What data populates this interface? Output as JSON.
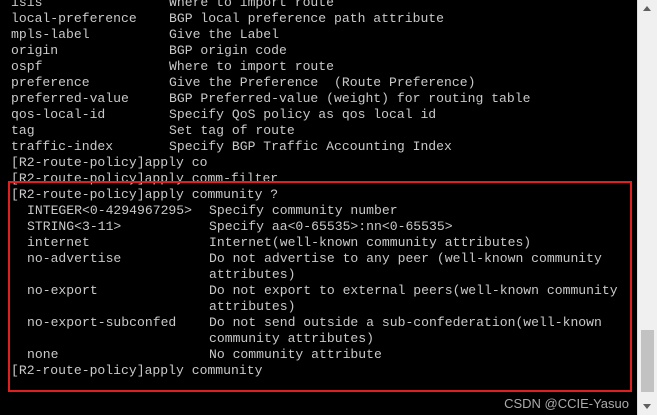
{
  "terminal": {
    "options_top": [
      {
        "name": "isis",
        "help": "Where to import route"
      },
      {
        "name": "local-preference",
        "help": "BGP local preference path attribute"
      },
      {
        "name": "mpls-label",
        "help": "Give the Label"
      },
      {
        "name": "origin",
        "help": "BGP origin code"
      },
      {
        "name": "ospf",
        "help": "Where to import route"
      },
      {
        "name": "preference",
        "help": "Give the Preference  (Route Preference)"
      },
      {
        "name": "preferred-value",
        "help": "BGP Preferred-value (weight) for routing table"
      },
      {
        "name": "qos-local-id",
        "help": "Specify QoS policy as qos local id"
      },
      {
        "name": "tag",
        "help": "Set tag of route"
      },
      {
        "name": "traffic-index",
        "help": "Specify BGP Traffic Accounting Index"
      }
    ],
    "commands_mid": [
      "[R2-route-policy]apply co",
      "[R2-route-policy]apply comm-filter",
      "[R2-route-policy]apply community ?"
    ],
    "community_options": [
      {
        "name": "INTEGER<0-4294967295>",
        "help": [
          "Specify community number"
        ]
      },
      {
        "name": "STRING<3-11>",
        "help": [
          "Specify aa<0-65535>:nn<0-65535>"
        ]
      },
      {
        "name": "internet",
        "help": [
          "Internet(well-known community attributes)"
        ]
      },
      {
        "name": "no-advertise",
        "help": [
          "Do not advertise to any peer (well-known community",
          "attributes)"
        ]
      },
      {
        "name": "no-export",
        "help": [
          "Do not export to external peers(well-known community",
          "attributes)"
        ]
      },
      {
        "name": "no-export-subconfed",
        "help": [
          "Do not send outside a sub-confederation(well-known",
          "community attributes)"
        ]
      },
      {
        "name": "none",
        "help": [
          "No community attribute"
        ]
      }
    ],
    "last_command": "[R2-route-policy]apply community"
  },
  "watermark": "CSDN @CCIE-Yasuo",
  "colors": {
    "background": "#000000",
    "text": "#c9c9c9",
    "highlight": "#e02020"
  }
}
